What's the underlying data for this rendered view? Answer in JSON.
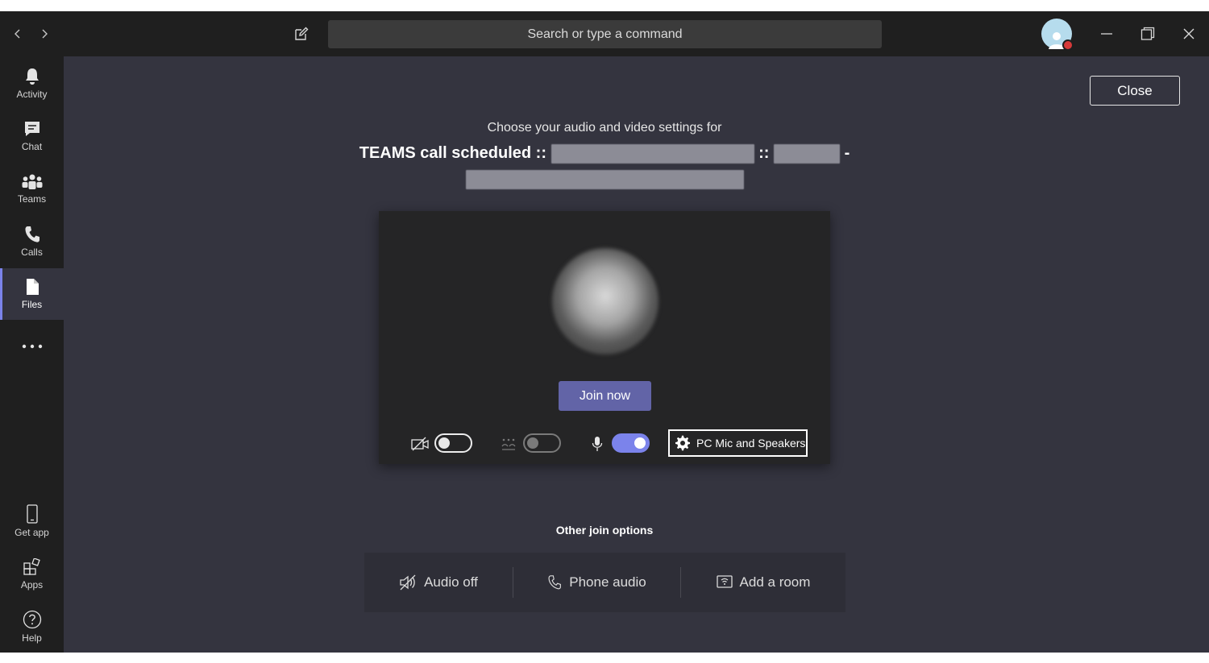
{
  "titlebar": {
    "search_placeholder": "Search or type a command"
  },
  "rail": {
    "items": [
      {
        "label": "Activity",
        "icon": "bell-icon"
      },
      {
        "label": "Chat",
        "icon": "chat-icon"
      },
      {
        "label": "Teams",
        "icon": "teams-icon"
      },
      {
        "label": "Calls",
        "icon": "phone-icon"
      },
      {
        "label": "Files",
        "icon": "file-icon",
        "active": true
      }
    ],
    "more": "...",
    "bottom": [
      {
        "label": "Get app",
        "icon": "mobile-icon"
      },
      {
        "label": "Apps",
        "icon": "apps-icon"
      },
      {
        "label": "Help",
        "icon": "help-icon"
      }
    ]
  },
  "main": {
    "close_label": "Close",
    "heading": "Choose your audio and video settings for",
    "title_prefix": "TEAMS call scheduled ::",
    "title_sep": "::",
    "title_dash": "-",
    "join_label": "Join now",
    "device_label": "PC Mic and Speakers",
    "toggles": {
      "camera": "off",
      "blur": "off",
      "mic": "on"
    },
    "other_join_label": "Other join options",
    "options": [
      {
        "label": "Audio off",
        "icon": "speaker-off-icon"
      },
      {
        "label": "Phone audio",
        "icon": "phone-icon"
      },
      {
        "label": "Add a room",
        "icon": "room-icon"
      }
    ]
  },
  "colors": {
    "accent": "#6264a7",
    "toggle_on": "#7b83eb",
    "background": "#34343f",
    "rail": "#1f1f1f"
  }
}
